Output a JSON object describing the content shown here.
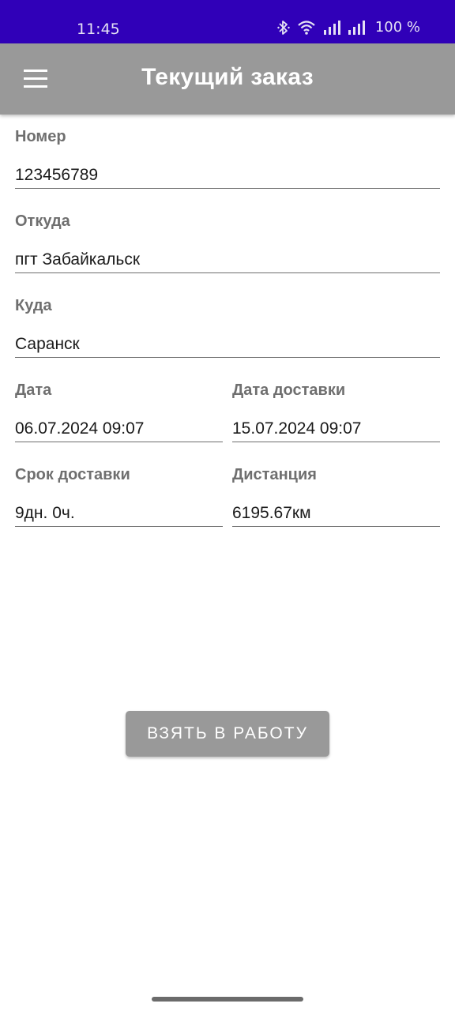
{
  "status_bar": {
    "time": "11:45",
    "battery": "100 %",
    "icons": [
      "bluetooth-icon",
      "wifi-icon",
      "signal-icon",
      "signal-icon"
    ],
    "background": "#3000b8"
  },
  "app_bar": {
    "title": "Текущий заказ",
    "menu_icon": "hamburger-menu-icon",
    "background": "#999999"
  },
  "form": {
    "number": {
      "label": "Номер",
      "value": "123456789"
    },
    "from": {
      "label": "Откуда",
      "value": "пгт Забайкальск"
    },
    "to": {
      "label": "Куда",
      "value": "Саранск"
    },
    "date": {
      "label": "Дата",
      "value": "06.07.2024 09:07"
    },
    "delivery_date": {
      "label": "Дата доставки",
      "value": "15.07.2024 09:07"
    },
    "delivery_term": {
      "label": "Срок доставки",
      "value": "9дн. 0ч."
    },
    "distance": {
      "label": "Дистанция",
      "value": "6195.67км"
    }
  },
  "actions": {
    "take_label": "ВЗЯТЬ В РАБОТУ"
  }
}
